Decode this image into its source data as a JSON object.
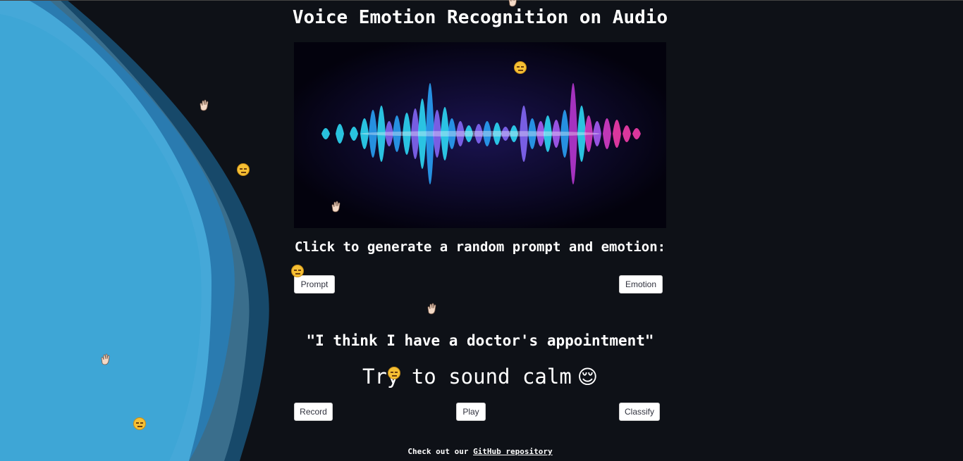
{
  "app": {
    "title": "Voice Emotion Recognition on Audio",
    "prompt_heading": "Click to generate a random prompt and emotion:",
    "quote": "\"I think I have a doctor's appointment\"",
    "target": {
      "prefix": "Try to sound calm",
      "emoji": "😌"
    }
  },
  "buttons": {
    "prompt": "Prompt",
    "emotion": "Emotion",
    "record": "Record",
    "play": "Play",
    "classify": "Classify"
  },
  "footer": {
    "prefix": "Check out our ",
    "link": "GitHub repository"
  },
  "colors": {
    "background": "#0e1117",
    "wave_light": "#3ea6d6",
    "wave_dark": "#1e6b96",
    "audio_cyan": "#1fd0ff",
    "audio_magenta": "#e040d0"
  },
  "icons": {
    "floating": [
      "waving-hand-icon",
      "relieved-face-icon"
    ]
  }
}
